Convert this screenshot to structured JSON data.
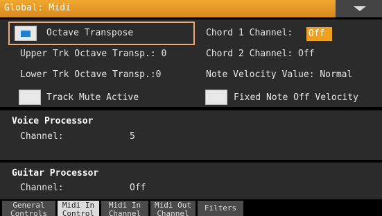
{
  "header": {
    "title": "Global: Midi"
  },
  "top_panel": {
    "octave_transpose": "Octave Transpose",
    "upper_trk": "Upper Trk Octave Transp.: 0",
    "lower_trk": "Lower Trk Octave Transp.:0",
    "track_mute": "Track Mute Active",
    "chord1_label": "Chord 1 Channel:",
    "chord1_value": "Off",
    "chord2": "Chord 2 Channel: Off",
    "note_velocity": "Note Velocity Value: Normal",
    "fixed_note_off": "Fixed Note Off Velocity"
  },
  "voice_processor": {
    "title": "Voice Processor",
    "channel_label": "Channel:",
    "channel_value": "5"
  },
  "guitar_processor": {
    "title": "Guitar Processor",
    "channel_label": "Channel:",
    "channel_value": "Off"
  },
  "tabs": [
    {
      "line1": "General",
      "line2": "Controls"
    },
    {
      "line1": "Midi In",
      "line2": "Control"
    },
    {
      "line1": "Midi In",
      "line2": "Channel"
    },
    {
      "line1": "Midi Out",
      "line2": "Channel"
    },
    {
      "line1": "Filters",
      "line2": ""
    }
  ],
  "colors": {
    "accent": "#f0a020",
    "selection_border": "#f0a87a",
    "checkbox_fill": "#1f7fd0"
  }
}
